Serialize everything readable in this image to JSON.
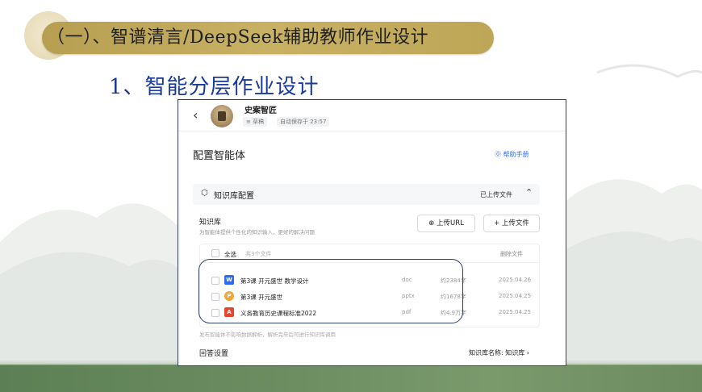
{
  "slide": {
    "heading": "（一）、智谱清言/DeepSeek辅助教师作业设计",
    "subheading": "1、智能分层作业设计"
  },
  "app": {
    "agent_name": "史案智匠",
    "status_draft": "≡ 草稿",
    "autosave": "自动保存于 23:57",
    "config_title": "配置智能体",
    "help_link": "⓪ 帮助手册",
    "kb_section": {
      "title": "知识库配置",
      "uploaded_label": "已上传文件",
      "label": "知识库",
      "description": "为智能体提供个性化的知识输入，更好的解决问题",
      "upload_url_label": "⊕ 上传URL",
      "upload_file_label": "+ 上传文件",
      "select_all": "全选",
      "file_count": "共3个文件",
      "delete_files": "删除文件",
      "files": [
        {
          "name": "第3课 开元盛世 教学设计",
          "type": "doc",
          "size": "约2384字",
          "date": "2025.04.26",
          "icon": "doc-icon",
          "color": "#2f6bf0",
          "glyph": "W"
        },
        {
          "name": "第3课 开元盛世",
          "type": "pptx",
          "size": "约1678字",
          "date": "2025.04.25",
          "icon": "ppt-icon",
          "color": "#f0a62f",
          "glyph": "P"
        },
        {
          "name": "义务教育历史课程标准2022",
          "type": "pdf",
          "size": "约4.9万字",
          "date": "2025.04.25",
          "icon": "pdf-icon",
          "color": "#e8452f",
          "glyph": "A"
        }
      ],
      "publish_note": "发布智能体不影响数据解析，解析完毕后可进行知识库调用"
    },
    "answer_settings": "回答设置",
    "kb_name_link": "知识库名称: 知识库 ›"
  },
  "colors": {
    "banner": "#c2aa5c",
    "subheading": "#1a3a99",
    "frame": "#2c3e6e",
    "link": "#3a6ee8",
    "band": "#6b8d60"
  }
}
